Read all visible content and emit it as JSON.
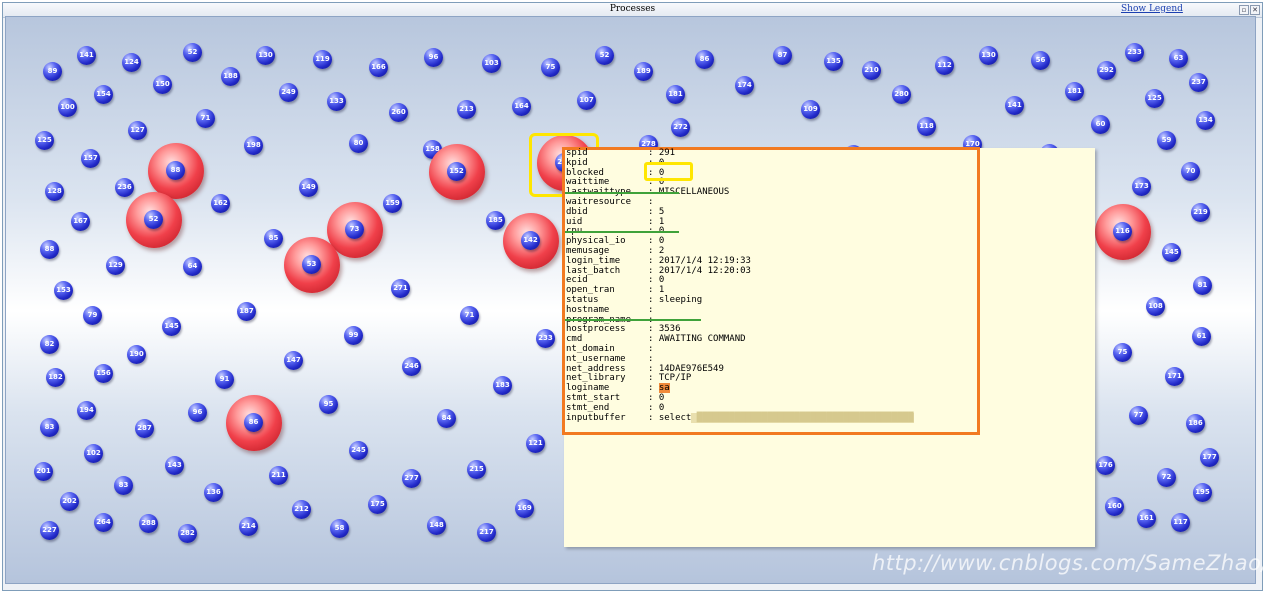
{
  "window": {
    "title": "Processes",
    "legend_link": "Show Legend",
    "buttons": [
      "▫",
      "✕"
    ]
  },
  "processes": {
    "small": [
      "141",
      "124",
      "52",
      "130",
      "119",
      "166",
      "96",
      "103",
      "75",
      "52",
      "189",
      "86",
      "87",
      "135",
      "210",
      "112",
      "130",
      "56",
      "292",
      "233",
      "63",
      "89",
      "154",
      "150",
      "188",
      "249",
      "133",
      "260",
      "213",
      "164",
      "107",
      "181",
      "174",
      "109",
      "280",
      "141",
      "181",
      "125",
      "237",
      "100",
      "71",
      "272",
      "118",
      "60",
      "134",
      "125",
      "127",
      "198",
      "80",
      "158",
      "278",
      "170",
      "59",
      "157",
      "85",
      "195",
      "70",
      "128",
      "236",
      "162",
      "149",
      "159",
      "185",
      "173",
      "167",
      "52",
      "85",
      "219",
      "88",
      "129",
      "64",
      "145",
      "153",
      "271",
      "81",
      "79",
      "145",
      "187",
      "71",
      "108",
      "82",
      "190",
      "99",
      "233",
      "61",
      "156",
      "147",
      "246",
      "75",
      "182",
      "91",
      "183",
      "171",
      "194",
      "96",
      "95",
      "84",
      "77",
      "83",
      "287",
      "186",
      "102",
      "245",
      "121",
      "177",
      "201",
      "143",
      "211",
      "277",
      "215",
      "176",
      "83",
      "136",
      "72",
      "202",
      "175",
      "212",
      "169",
      "160",
      "195",
      "264",
      "288",
      "214",
      "148",
      "161",
      "117",
      "227",
      "282",
      "58",
      "217"
    ],
    "large": [
      "88",
      "52",
      "73",
      "53",
      "152",
      "142",
      "86",
      "116",
      "291"
    ]
  },
  "tooltip": {
    "rows": [
      {
        "key": "spid",
        "value": "291"
      },
      {
        "key": "kpid",
        "value": "0"
      },
      {
        "key": "blocked",
        "value": "0"
      },
      {
        "key": "waittime",
        "value": "0"
      },
      {
        "key": "lastwaittype",
        "value": "MISCELLANEOUS"
      },
      {
        "key": "waitresource",
        "value": ""
      },
      {
        "key": "dbid",
        "value": "5"
      },
      {
        "key": "uid",
        "value": "1"
      },
      {
        "key": "cpu",
        "value": "0"
      },
      {
        "key": "physical_io",
        "value": "0"
      },
      {
        "key": "memusage",
        "value": "2"
      },
      {
        "key": "login_time",
        "value": "2017/1/4 12:19:33"
      },
      {
        "key": "last_batch",
        "value": "2017/1/4 12:20:03"
      },
      {
        "key": "ecid",
        "value": "0"
      },
      {
        "key": "open_tran",
        "value": "1"
      },
      {
        "key": "status",
        "value": "sleeping"
      },
      {
        "key": "hostname",
        "value": ""
      },
      {
        "key": "program_name",
        "value": ""
      },
      {
        "key": "hostprocess",
        "value": "3536"
      },
      {
        "key": "cmd",
        "value": "AWAITING COMMAND"
      },
      {
        "key": "nt_domain",
        "value": ""
      },
      {
        "key": "nt_username",
        "value": ""
      },
      {
        "key": "net_address",
        "value": "14DAE976E549"
      },
      {
        "key": "net_library",
        "value": "TCP/IP"
      },
      {
        "key": "loginame",
        "value": "sa"
      },
      {
        "key": "stmt_start",
        "value": "0"
      },
      {
        "key": "stmt_end",
        "value": "0"
      },
      {
        "key": "inputbuffer",
        "value": "select"
      }
    ]
  },
  "watermark": "http://www.cnblogs.com/SameZhao/",
  "colors": {
    "highlight_orange": "#f27a21",
    "highlight_yellow": "#ffe600",
    "underline_green": "#3fa23a",
    "process_blue": "#2229c9",
    "process_red": "#f0404a"
  }
}
